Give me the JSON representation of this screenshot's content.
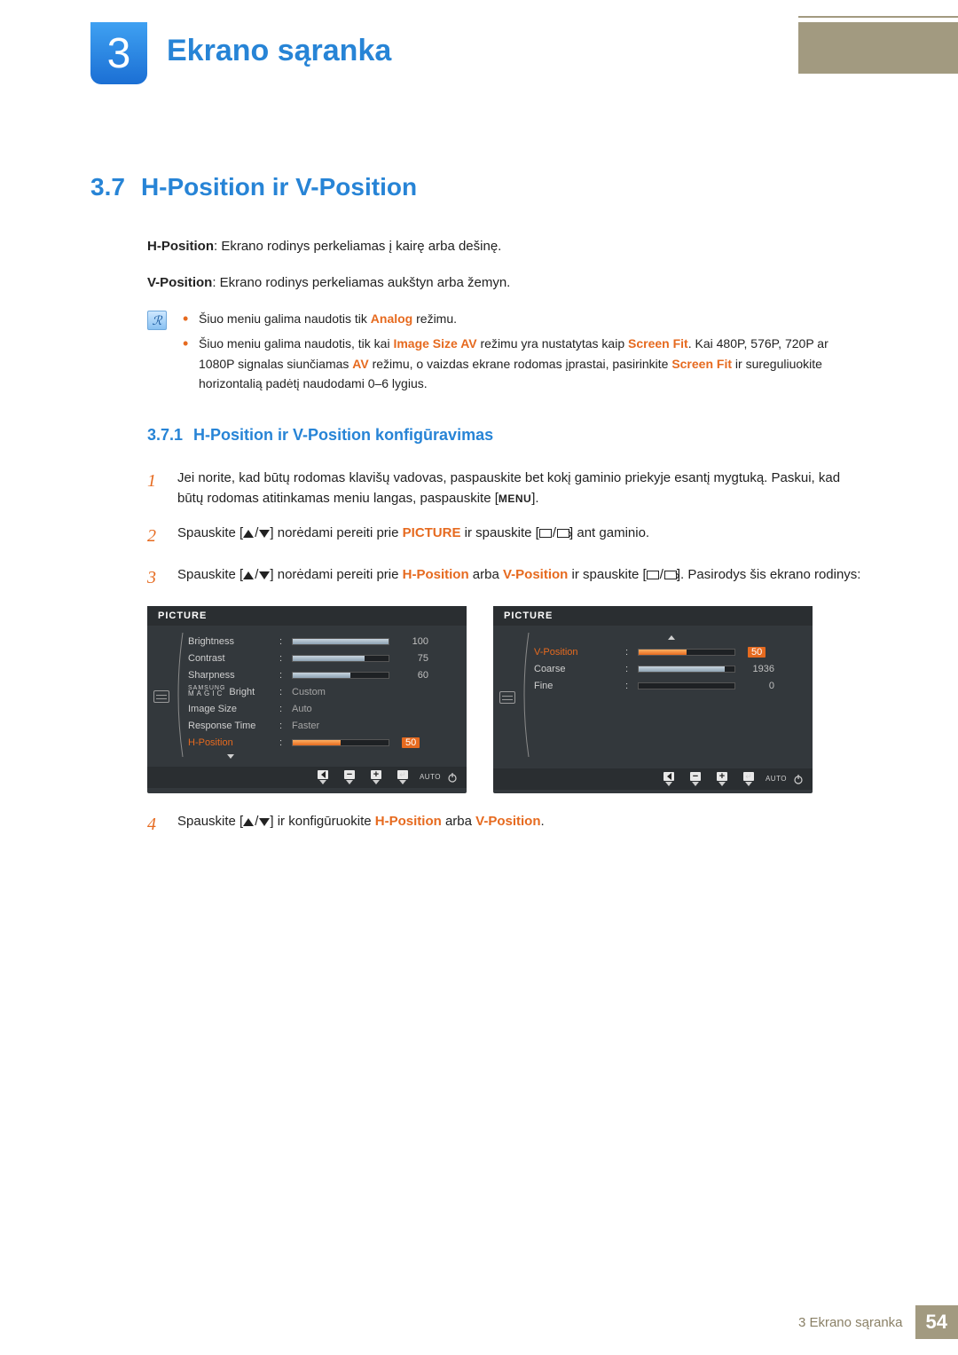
{
  "chapter": {
    "number": "3",
    "title": "Ekrano sąranka"
  },
  "section": {
    "number": "3.7",
    "title": "H-Position ir V-Position"
  },
  "intro": {
    "hpos_label": "H-Position",
    "hpos_desc": ": Ekrano rodinys perkeliamas į kairę arba dešinę.",
    "vpos_label": "V-Position",
    "vpos_desc": ": Ekrano rodinys perkeliamas aukštyn arba žemyn."
  },
  "notes": {
    "item1_pre": "Šiuo meniu galima naudotis tik ",
    "item1_hl": "Analog",
    "item1_post": " režimu.",
    "item2_pre": "Šiuo meniu galima naudotis, tik kai ",
    "item2_hl1": "Image Size AV",
    "item2_mid1": " režimu yra nustatytas kaip ",
    "item2_hl2": "Screen Fit",
    "item2_mid2": ". Kai 480P, 576P, 720P ar 1080P signalas siunčiamas ",
    "item2_hl3": "AV",
    "item2_mid3": " režimu, o vaizdas ekrane rodomas įprastai, pasirinkite ",
    "item2_hl4": "Screen Fit",
    "item2_post": " ir sureguliuokite horizontalią padėtį naudodami 0–6 lygius."
  },
  "subsection": {
    "number": "3.7.1",
    "title": "H-Position ir V-Position konfigūravimas"
  },
  "steps": {
    "s1_num": "1",
    "s1_a": "Jei norite, kad būtų rodomas klavišų vadovas, paspauskite bet kokį gaminio priekyje esantį mygtuką. Paskui, kad būtų rodomas atitinkamas meniu langas, paspauskite [",
    "s1_menu": "MENU",
    "s1_b": "].",
    "s2_num": "2",
    "s2_a": "Spauskite [",
    "s2_b": "] norėdami pereiti prie ",
    "s2_hl": "PICTURE",
    "s2_c": " ir spauskite [",
    "s2_d": "] ant gaminio.",
    "s3_num": "3",
    "s3_a": "Spauskite [",
    "s3_b": "] norėdami pereiti prie ",
    "s3_hl1": "H-Position",
    "s3_mid": " arba ",
    "s3_hl2": "V-Position",
    "s3_c": " ir spauskite [",
    "s3_d": "]. Pasirodys šis ekrano rodinys:",
    "s4_num": "4",
    "s4_a": "Spauskite [",
    "s4_b": "] ir konfigūruokite ",
    "s4_hl1": "H-Position",
    "s4_mid": " arba ",
    "s4_hl2": "V-Position",
    "s4_post": "."
  },
  "osd_left": {
    "title": "PICTURE",
    "items": [
      {
        "label": "Brightness",
        "slider": 100,
        "value": "100"
      },
      {
        "label": "Contrast",
        "slider": 75,
        "value": "75"
      },
      {
        "label": "Sharpness",
        "slider": 60,
        "value": "60"
      },
      {
        "magic_top": "SAMSUNG",
        "magic_bot": "MAGIC",
        "label_suffix": "Bright",
        "text": "Custom"
      },
      {
        "label": "Image Size",
        "text": "Auto"
      },
      {
        "label": "Response Time",
        "text": "Faster"
      },
      {
        "label": "H-Position",
        "highlight": true,
        "slider": 50,
        "value": "50",
        "orange": true
      }
    ],
    "auto_label": "AUTO"
  },
  "osd_right": {
    "title": "PICTURE",
    "items": [
      {
        "label": "V-Position",
        "highlight": true,
        "slider": 50,
        "value": "50",
        "orange": true
      },
      {
        "label": "Coarse",
        "slider": 90,
        "value": "1936"
      },
      {
        "label": "Fine",
        "slider": 0,
        "value": "0"
      }
    ],
    "auto_label": "AUTO"
  },
  "footer": {
    "text": "3 Ekrano sąranka",
    "page": "54"
  }
}
